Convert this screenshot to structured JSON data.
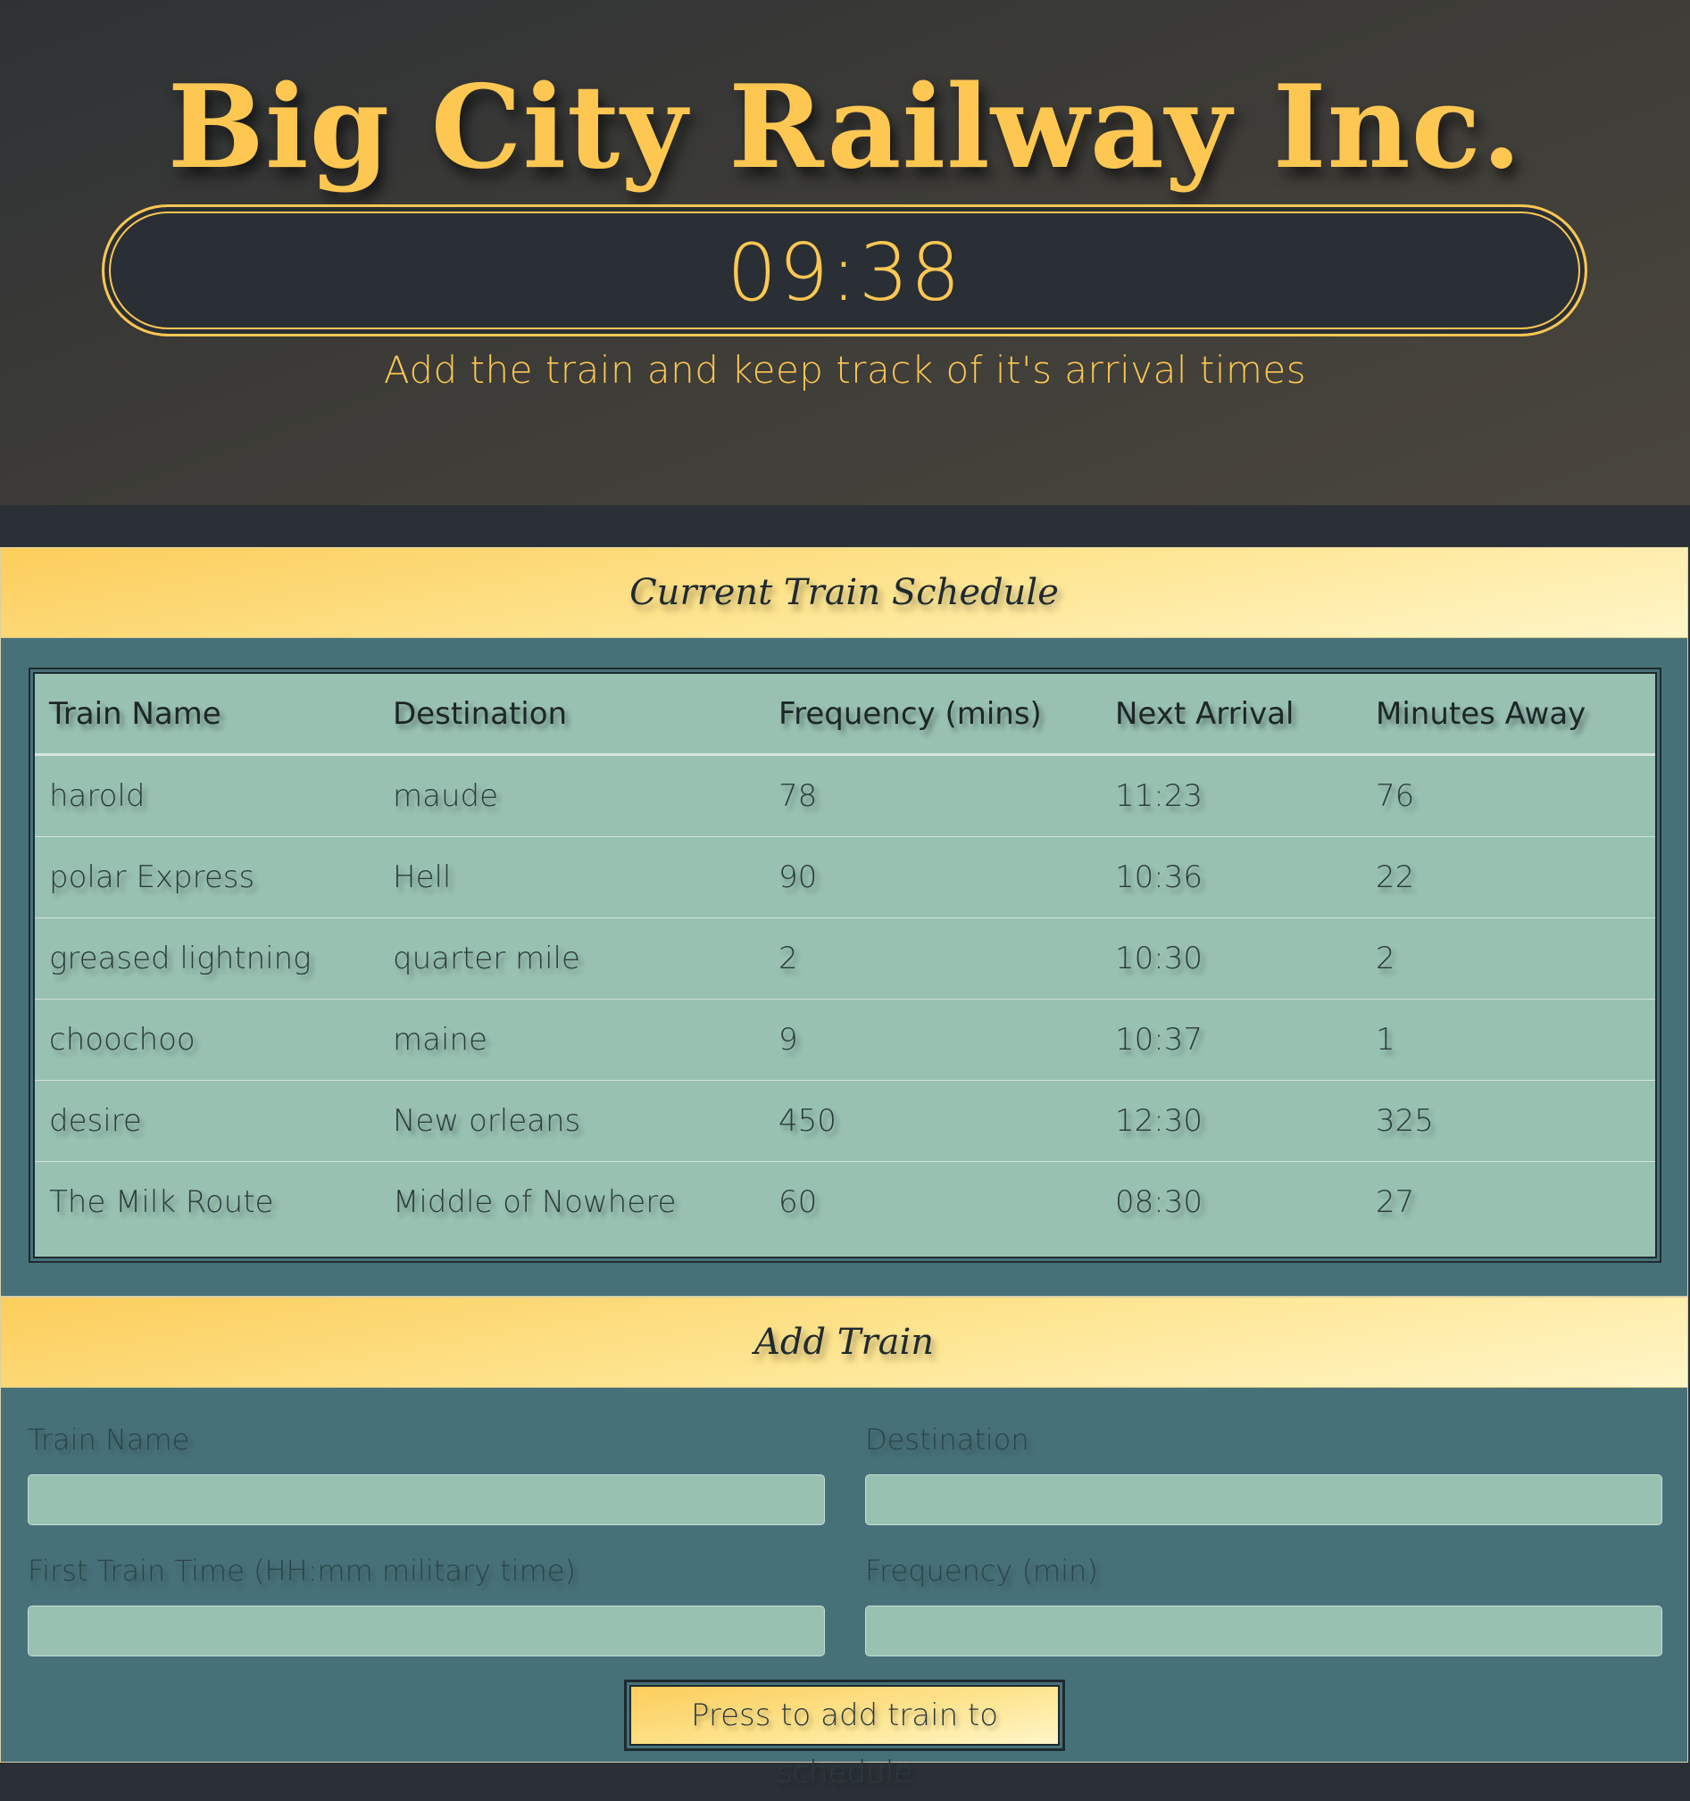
{
  "hero": {
    "title": "Big City Railway Inc.",
    "clock": "09:38",
    "tagline": "Add the train and keep track of it's arrival times"
  },
  "schedule": {
    "heading": "Current Train Schedule",
    "columns": [
      "Train Name",
      "Destination",
      "Frequency (mins)",
      "Next Arrival",
      "Minutes Away"
    ],
    "rows": [
      [
        "harold",
        "maude",
        "78",
        "11:23",
        "76"
      ],
      [
        "polar Express",
        "Hell",
        "90",
        "10:36",
        "22"
      ],
      [
        "greased lightning",
        "quarter mile",
        "2",
        "10:30",
        "2"
      ],
      [
        "choochoo",
        "maine",
        "9",
        "10:37",
        "1"
      ],
      [
        "desire",
        "New orleans",
        "450",
        "12:30",
        "325"
      ],
      [
        "The Milk Route",
        "Middle of Nowhere",
        "60",
        "08:30",
        "27"
      ]
    ]
  },
  "add_train": {
    "heading": "Add Train",
    "train_name_label": "Train Name",
    "train_name_value": "",
    "destination_label": "Destination",
    "destination_value": "",
    "first_time_label": "First Train Time (HH:mm military time)",
    "first_time_value": "",
    "frequency_label": "Frequency (min)",
    "frequency_value": "",
    "submit_label": "Press to add train to schedule"
  },
  "colors": {
    "accent": "#fdc752",
    "panel": "#477179",
    "table": "#98c1b1",
    "dark": "#2b3036"
  }
}
